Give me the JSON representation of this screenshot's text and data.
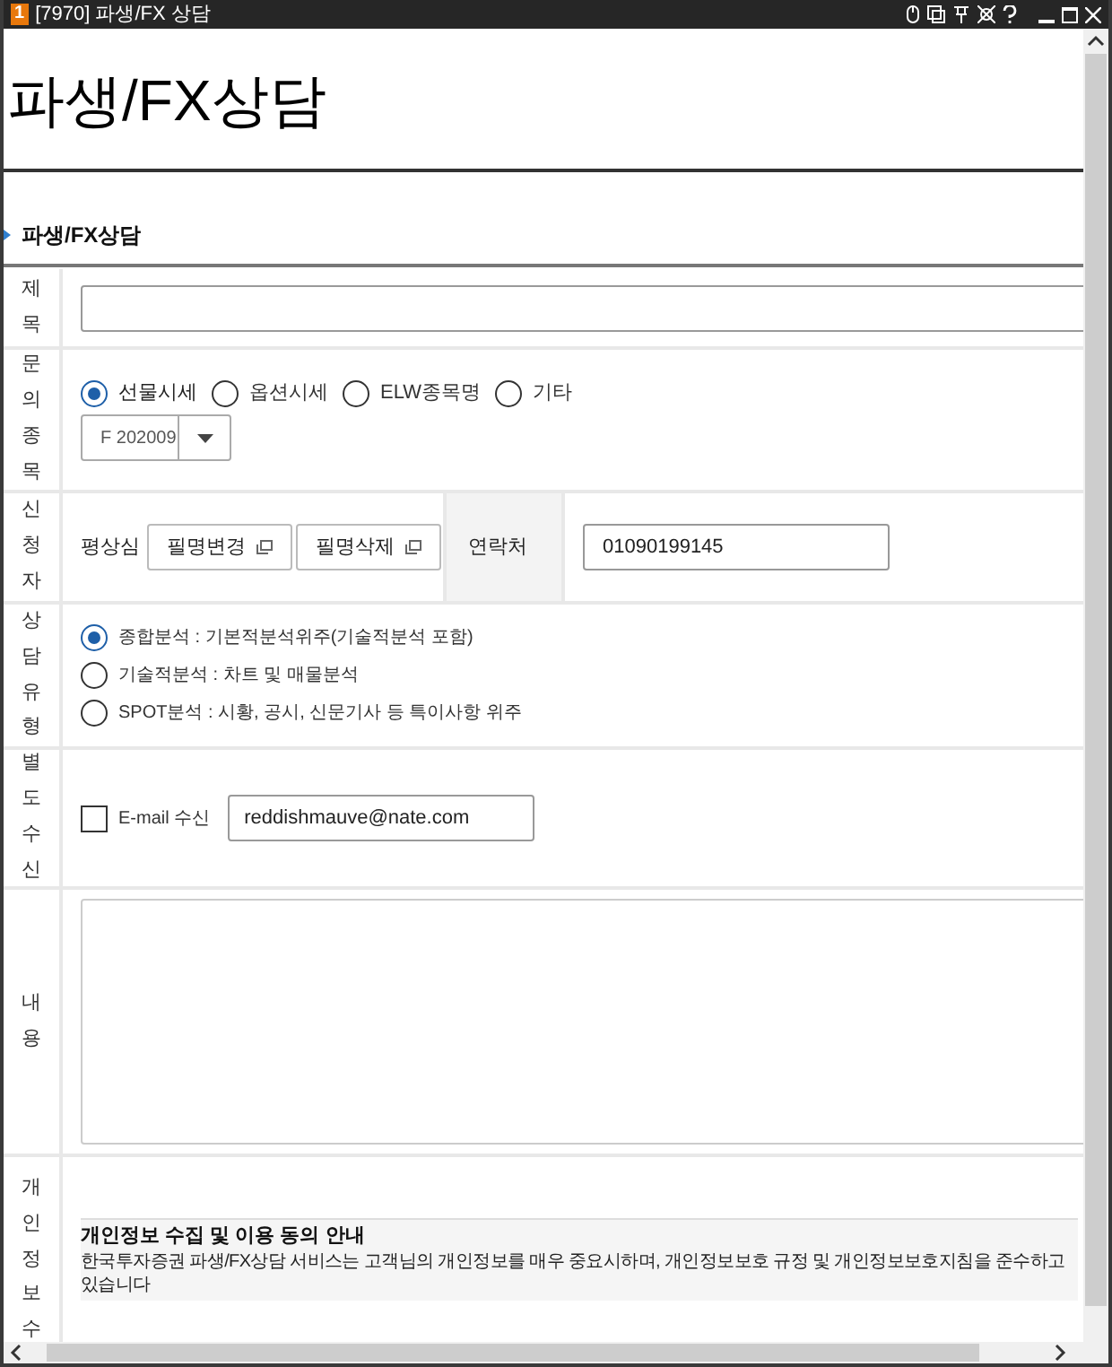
{
  "window": {
    "badge": "1",
    "title": "[7970] 파생/FX 상담"
  },
  "page_title": "파생/FX상담",
  "section_title": "파생/FX상담",
  "rows": [
    {
      "kind": "subject",
      "label": "제목"
    },
    {
      "kind": "inquiry",
      "label": "문의종목",
      "options": [
        {
          "label": "선물시세",
          "selected": true
        },
        {
          "label": "옵션시세",
          "selected": false
        },
        {
          "label": "ELW종목명",
          "selected": false
        },
        {
          "label": "기타",
          "selected": false
        }
      ],
      "dropdown": "F 202009"
    },
    {
      "kind": "applicant",
      "label": "신청자",
      "name": "평상심",
      "buttons": [
        "필명변경",
        "필명삭제"
      ],
      "contact_label": "연락처",
      "contact_value": "01090199145"
    },
    {
      "kind": "consult_type",
      "label": "상담유형",
      "options": [
        {
          "label": "종합분석 : 기본적분석위주(기술적분석 포함)",
          "selected": true
        },
        {
          "label": "기술적분석 : 차트 및 매물분석",
          "selected": false
        },
        {
          "label": "SPOT분석 : 시황, 공시, 신문기사 등 특이사항 위주",
          "selected": false
        }
      ]
    },
    {
      "kind": "extra",
      "label": "별도수신",
      "email_label": "E-mail 수신",
      "checked": false,
      "email": "reddishmauve@nate.com"
    },
    {
      "kind": "content",
      "label": "내용"
    },
    {
      "kind": "privacy",
      "label": "개인정보수",
      "heading": "개인정보 수집 및 이용 동의 안내",
      "text": "한국투자증권 파생/FX상담 서비스는 고객님의 개인정보를 매우 중요시하며, 개인정보보호 규정 및 개인정보보호지침을 준수하고 있습니다"
    }
  ]
}
